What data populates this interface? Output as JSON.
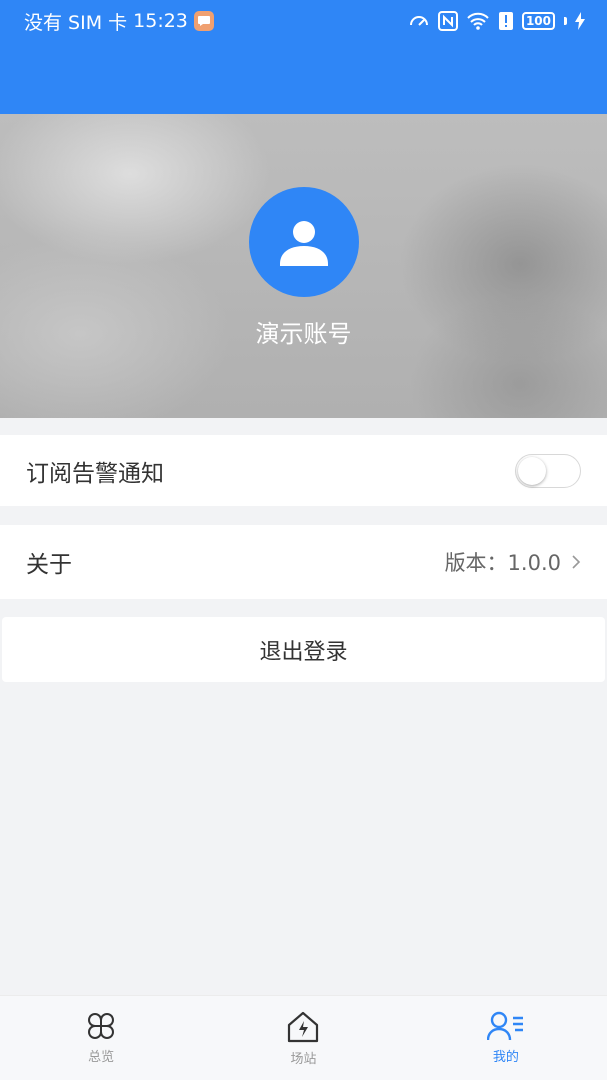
{
  "status_bar": {
    "carrier": "没有 SIM 卡",
    "time": "15:23",
    "battery": "100",
    "icons": [
      "speed-icon",
      "nfc-icon",
      "wifi-icon",
      "alert-icon",
      "battery-icon",
      "charging-icon"
    ]
  },
  "profile": {
    "username": "演示账号"
  },
  "settings": {
    "alert_label": "订阅告警通知",
    "alert_enabled": false,
    "about_label": "关于",
    "version_text": "版本：1.0.0",
    "logout_label": "退出登录"
  },
  "nav": {
    "items": [
      {
        "label": "总览",
        "icon": "overview-icon",
        "active": false
      },
      {
        "label": "场站",
        "icon": "station-icon",
        "active": false
      },
      {
        "label": "我的",
        "icon": "profile-icon",
        "active": true
      }
    ]
  },
  "colors": {
    "accent": "#2f86f6",
    "background": "#f2f3f5"
  }
}
